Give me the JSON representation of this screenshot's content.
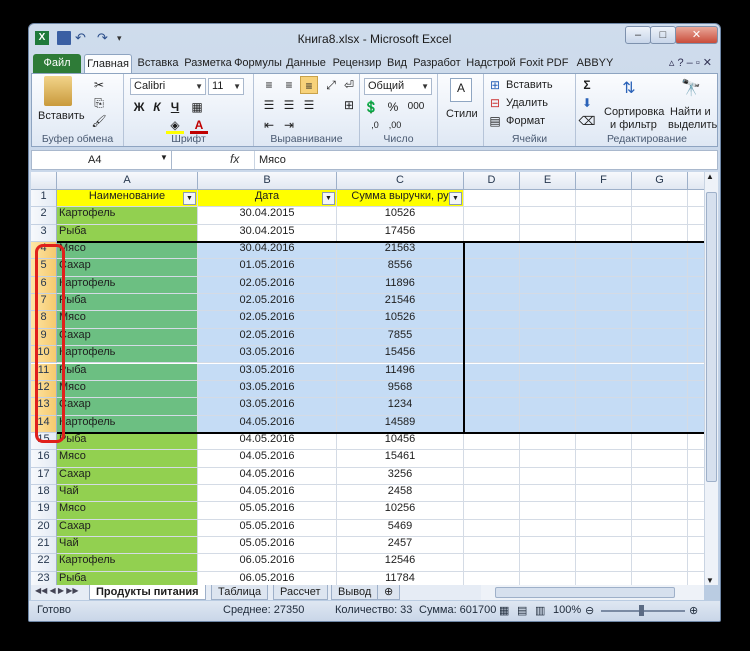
{
  "window": {
    "title": "Книга8.xlsx - Microsoft Excel",
    "controls": {
      "minimize": "–",
      "maximize": "□",
      "close": "✕"
    }
  },
  "tabs": [
    "Файл",
    "Главная",
    "Вставка",
    "Разметка",
    "Формулы",
    "Данные",
    "Рецензир",
    "Вид",
    "Разработ",
    "Надстрой",
    "Foxit PDF",
    "ABBYY PD"
  ],
  "ribbon": {
    "clipboard": {
      "paste": "Вставить",
      "label": "Буфер обмена"
    },
    "font": {
      "name": "Calibri",
      "size": "11",
      "bold": "Ж",
      "italic": "К",
      "underline": "Ч",
      "label": "Шрифт"
    },
    "alignment": {
      "label": "Выравнивание"
    },
    "number": {
      "format": "Общий",
      "percent": "%",
      "thousands": "000",
      "label": "Число"
    },
    "styles": {
      "label": "Стили"
    },
    "cells": {
      "insert": "Вставить",
      "delete": "Удалить",
      "format": "Формат",
      "label": "Ячейки"
    },
    "editing": {
      "sort": "Сортировка",
      "sort2": "и фильтр",
      "find": "Найти и",
      "find2": "выделить",
      "label": "Редактирование"
    }
  },
  "formula_bar": {
    "name_box": "A4",
    "fx": "fx",
    "formula": "Мясо"
  },
  "columns": [
    "A",
    "B",
    "C",
    "D",
    "E",
    "F",
    "G"
  ],
  "header_row": {
    "a": "Наименование",
    "b": "Дата",
    "c": "Сумма выручки, ру"
  },
  "rows": [
    {
      "n": "2",
      "name": "Картофель",
      "date": "30.04.2015",
      "sum": "10526"
    },
    {
      "n": "3",
      "name": "Рыба",
      "date": "30.04.2015",
      "sum": "17456"
    },
    {
      "n": "4",
      "name": "Мясо",
      "date": "30.04.2016",
      "sum": "21563"
    },
    {
      "n": "5",
      "name": "Сахар",
      "date": "01.05.2016",
      "sum": "8556"
    },
    {
      "n": "6",
      "name": "Картофель",
      "date": "02.05.2016",
      "sum": "11896"
    },
    {
      "n": "7",
      "name": "Рыба",
      "date": "02.05.2016",
      "sum": "21546"
    },
    {
      "n": "8",
      "name": "Мясо",
      "date": "02.05.2016",
      "sum": "10526"
    },
    {
      "n": "9",
      "name": "Сахар",
      "date": "02.05.2016",
      "sum": "7855"
    },
    {
      "n": "10",
      "name": "Картофель",
      "date": "03.05.2016",
      "sum": "15456"
    },
    {
      "n": "11",
      "name": "Рыба",
      "date": "03.05.2016",
      "sum": "11496"
    },
    {
      "n": "12",
      "name": "Мясо",
      "date": "03.05.2016",
      "sum": "9568"
    },
    {
      "n": "13",
      "name": "Сахар",
      "date": "03.05.2016",
      "sum": "1234"
    },
    {
      "n": "14",
      "name": "Картофель",
      "date": "04.05.2016",
      "sum": "14589"
    },
    {
      "n": "15",
      "name": "Рыба",
      "date": "04.05.2016",
      "sum": "10456"
    },
    {
      "n": "16",
      "name": "Мясо",
      "date": "04.05.2016",
      "sum": "15461"
    },
    {
      "n": "17",
      "name": "Сахар",
      "date": "04.05.2016",
      "sum": "3256"
    },
    {
      "n": "18",
      "name": "Чай",
      "date": "04.05.2016",
      "sum": "2458"
    },
    {
      "n": "19",
      "name": "Мясо",
      "date": "05.05.2016",
      "sum": "10256"
    },
    {
      "n": "20",
      "name": "Сахар",
      "date": "05.05.2016",
      "sum": "5469"
    },
    {
      "n": "21",
      "name": "Чай",
      "date": "05.05.2016",
      "sum": "2457"
    },
    {
      "n": "22",
      "name": "Картофель",
      "date": "06.05.2016",
      "sum": "12546"
    },
    {
      "n": "23",
      "name": "Рыба",
      "date": "06.05.2016",
      "sum": "11784"
    }
  ],
  "selected_rows": [
    "4",
    "14"
  ],
  "sheets": [
    "Продукты питания",
    "Таблица",
    "Рассчет",
    "Вывод"
  ],
  "status": {
    "ready": "Готово",
    "average": "Среднее: 27350",
    "count": "Количество: 33",
    "sum": "Сумма: 601700",
    "zoom": "100%"
  }
}
